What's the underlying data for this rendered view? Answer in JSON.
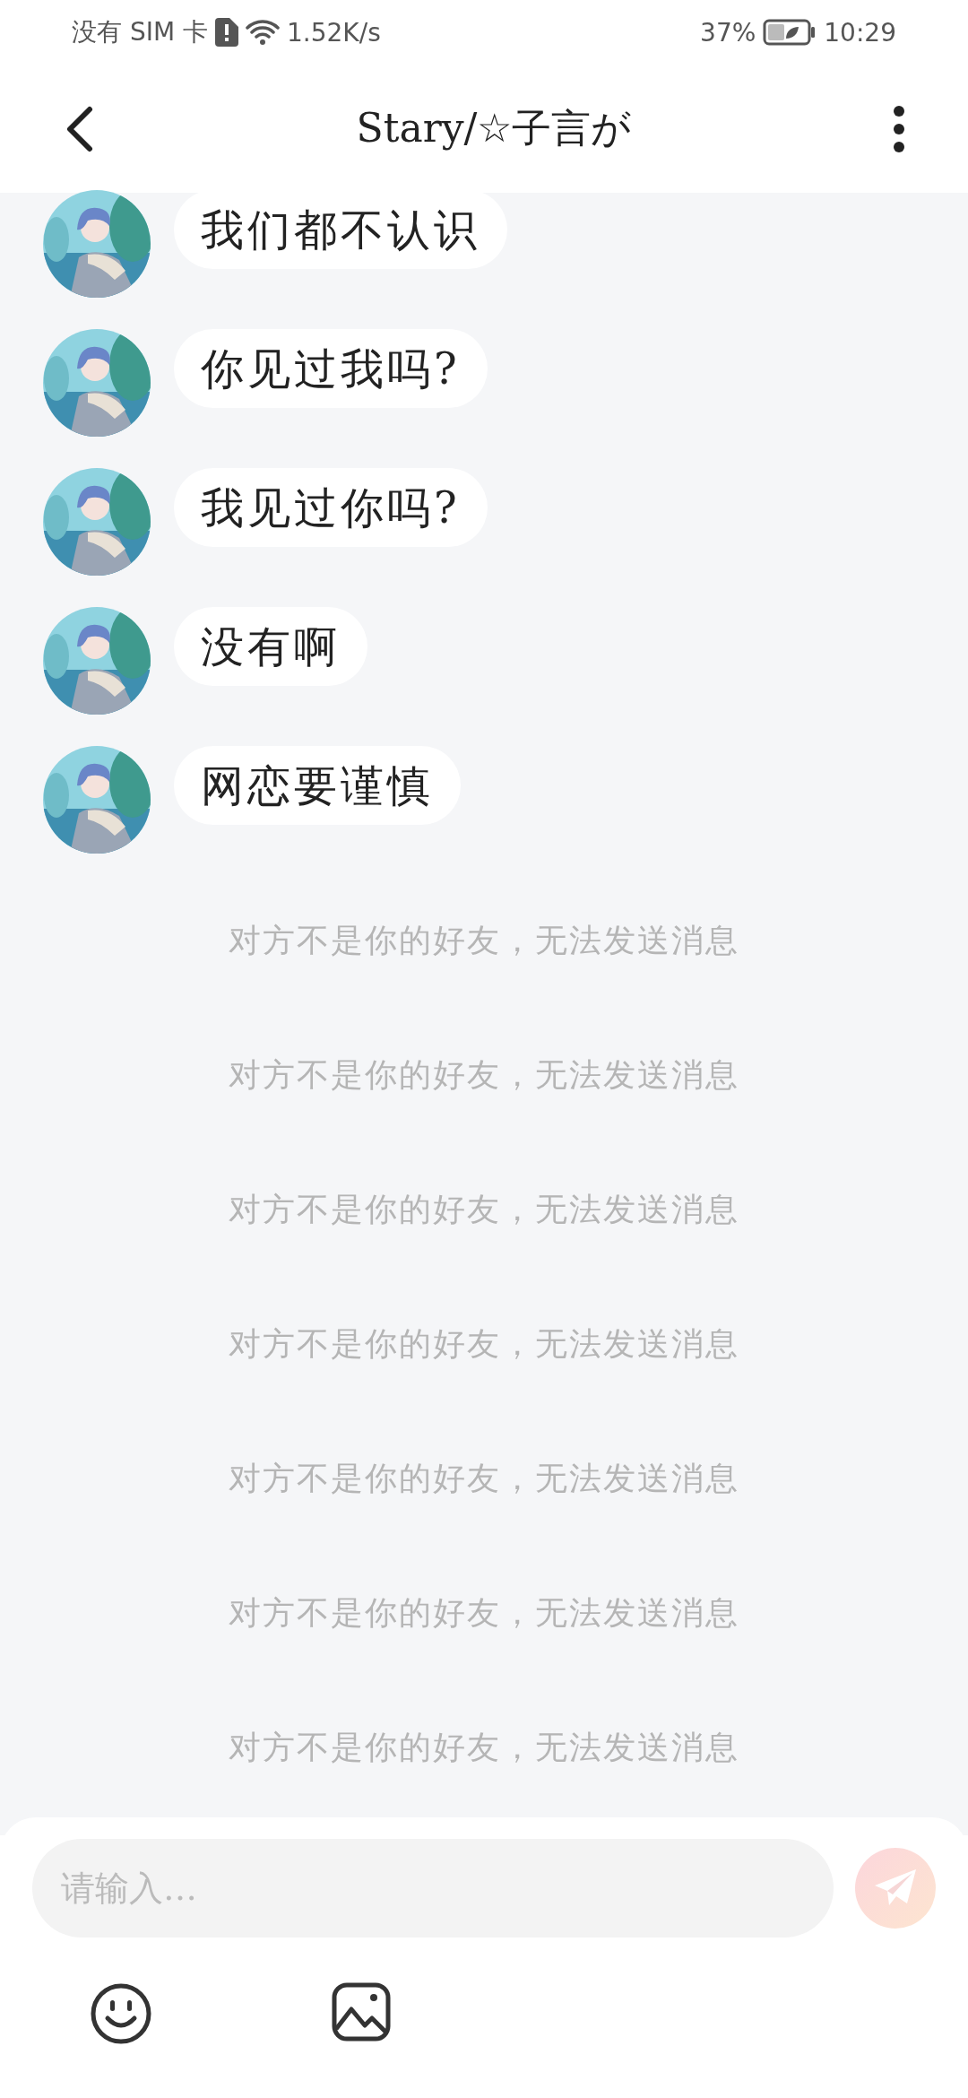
{
  "status_bar": {
    "carrier": "没有 SIM 卡",
    "net_speed": "1.52K/s",
    "battery": "37%",
    "time": "10:29"
  },
  "header": {
    "title": "Stary/☆子言が"
  },
  "messages": [
    {
      "text": "我们都不认识"
    },
    {
      "text": "你见过我吗?"
    },
    {
      "text": "我见过你吗?"
    },
    {
      "text": "没有啊"
    },
    {
      "text": "网恋要谨慎"
    }
  ],
  "notices": [
    "对方不是你的好友，无法发送消息",
    "对方不是你的好友，无法发送消息",
    "对方不是你的好友，无法发送消息",
    "对方不是你的好友，无法发送消息",
    "对方不是你的好友，无法发送消息",
    "对方不是你的好友，无法发送消息",
    "对方不是你的好友，无法发送消息"
  ],
  "composer": {
    "placeholder": "请输入…"
  }
}
